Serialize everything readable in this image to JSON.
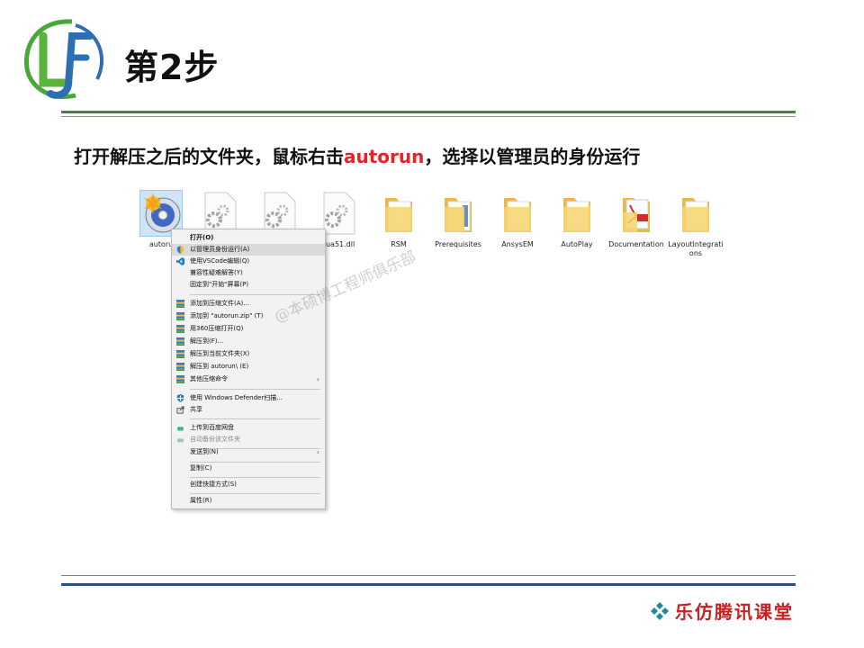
{
  "header": {
    "step_title": "第2步"
  },
  "instruction": {
    "before": "打开解压之后的文件夹，鼠标右击",
    "highlight": "autorun",
    "after": "，选择以管理员的身份运行"
  },
  "colors": {
    "green_rule": "#3a8a3a",
    "blue_rule": "#2e4f84",
    "highlight": "#e0262a",
    "brand": "#cc1f1f"
  },
  "files": [
    {
      "label": "autoru",
      "icon": "disc-autorun-icon",
      "selected": true
    },
    {
      "label": "",
      "icon": "gear-file-icon"
    },
    {
      "label": "",
      "icon": "gear-file-icon"
    },
    {
      "label": "lua51.dll",
      "icon": "gear-file-icon"
    },
    {
      "label": "RSM",
      "icon": "folder-icon"
    },
    {
      "label": "Prerequisites",
      "icon": "folder-icon"
    },
    {
      "label": "AnsysEM",
      "icon": "folder-icon"
    },
    {
      "label": "AutoPlay",
      "icon": "folder-icon"
    },
    {
      "label": "Documentation",
      "icon": "pdf-folder-icon"
    },
    {
      "label": "LayoutIntegrations",
      "icon": "folder-icon"
    }
  ],
  "context_menu": {
    "open": "打开(O)",
    "run_as_admin": "以管理员身份运行(A)",
    "open_vscode": "使用VSCode编辑(Q)",
    "compat": "兼容性疑难解答(Y)",
    "pin_start": "固定到\"开始\"屏幕(P)",
    "add_archive": "添加到压缩文件(A)...",
    "add_zip": "添加到 \"autorun.zip\" (T)",
    "open_360": "用360压缩打开(Q)",
    "extract_to": "解压到(F)...",
    "extract_here": "解压到当前文件夹(X)",
    "extract_folder": "解压到 autorun\\ (E)",
    "other_compress": "其他压缩命令",
    "defender": "使用 Windows Defender扫描...",
    "share": "共享",
    "baidu_upload": "上传到百度网盘",
    "baidu_backup": "自动备份该文件夹",
    "send_to": "发送到(N)",
    "copy": "复制(C)",
    "shortcut": "创建快捷方式(S)",
    "properties": "属性(R)"
  },
  "watermark": "@本硕博工程师俱乐部",
  "footer": {
    "brand": "乐仿腾讯课堂"
  }
}
